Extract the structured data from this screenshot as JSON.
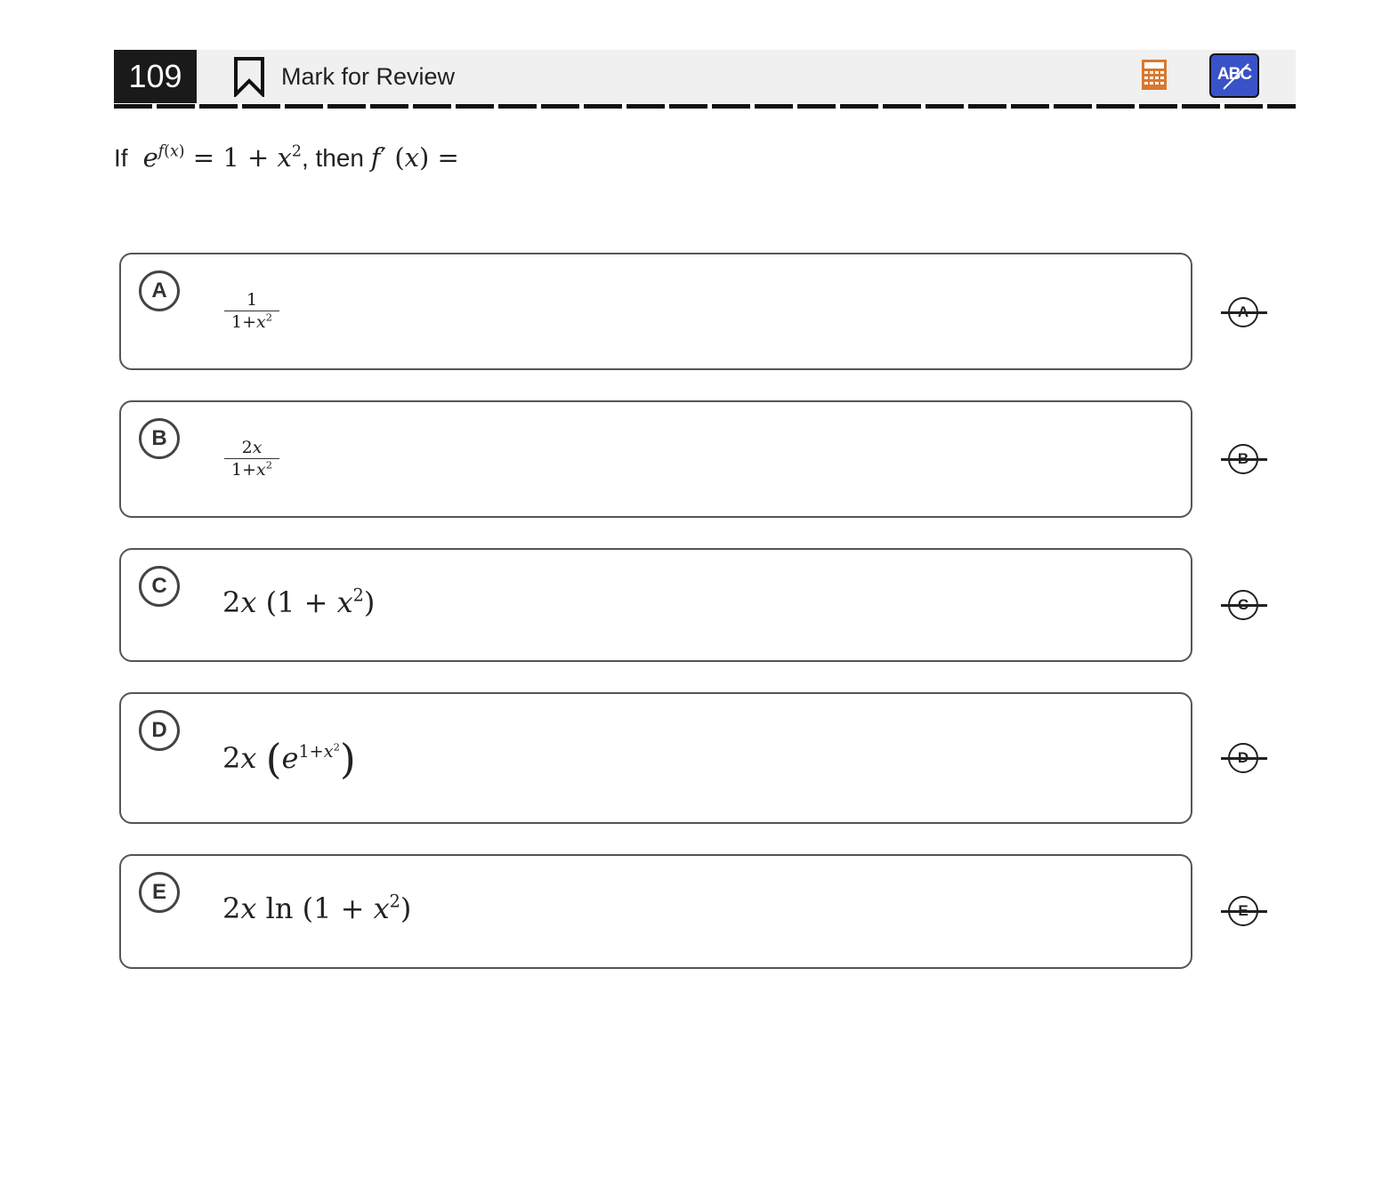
{
  "header": {
    "question_number": "109",
    "mark_for_review_label": "Mark for Review",
    "abc_label": "ABC",
    "calculator_color": "#d9782e",
    "abc_button_color": "#3a52c7"
  },
  "question": {
    "prefix": "If",
    "middle": ", then"
  },
  "choices": [
    {
      "letter": "A",
      "expr": "1/(1+x²)"
    },
    {
      "letter": "B",
      "expr": "2x/(1+x²)"
    },
    {
      "letter": "C",
      "expr": "2x(1+x²)"
    },
    {
      "letter": "D",
      "expr": "2x(e^(1+x²))"
    },
    {
      "letter": "E",
      "expr": "2x ln(1+x²)"
    }
  ]
}
